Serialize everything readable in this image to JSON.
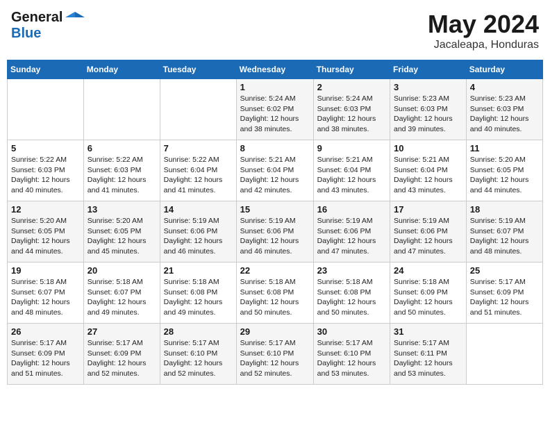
{
  "header": {
    "logo_general": "General",
    "logo_blue": "Blue",
    "title": "May 2024",
    "subtitle": "Jacaleapa, Honduras"
  },
  "weekdays": [
    "Sunday",
    "Monday",
    "Tuesday",
    "Wednesday",
    "Thursday",
    "Friday",
    "Saturday"
  ],
  "weeks": [
    [
      {
        "day": "",
        "info": ""
      },
      {
        "day": "",
        "info": ""
      },
      {
        "day": "",
        "info": ""
      },
      {
        "day": "1",
        "info": "Sunrise: 5:24 AM\nSunset: 6:02 PM\nDaylight: 12 hours\nand 38 minutes."
      },
      {
        "day": "2",
        "info": "Sunrise: 5:24 AM\nSunset: 6:03 PM\nDaylight: 12 hours\nand 38 minutes."
      },
      {
        "day": "3",
        "info": "Sunrise: 5:23 AM\nSunset: 6:03 PM\nDaylight: 12 hours\nand 39 minutes."
      },
      {
        "day": "4",
        "info": "Sunrise: 5:23 AM\nSunset: 6:03 PM\nDaylight: 12 hours\nand 40 minutes."
      }
    ],
    [
      {
        "day": "5",
        "info": "Sunrise: 5:22 AM\nSunset: 6:03 PM\nDaylight: 12 hours\nand 40 minutes."
      },
      {
        "day": "6",
        "info": "Sunrise: 5:22 AM\nSunset: 6:03 PM\nDaylight: 12 hours\nand 41 minutes."
      },
      {
        "day": "7",
        "info": "Sunrise: 5:22 AM\nSunset: 6:04 PM\nDaylight: 12 hours\nand 41 minutes."
      },
      {
        "day": "8",
        "info": "Sunrise: 5:21 AM\nSunset: 6:04 PM\nDaylight: 12 hours\nand 42 minutes."
      },
      {
        "day": "9",
        "info": "Sunrise: 5:21 AM\nSunset: 6:04 PM\nDaylight: 12 hours\nand 43 minutes."
      },
      {
        "day": "10",
        "info": "Sunrise: 5:21 AM\nSunset: 6:04 PM\nDaylight: 12 hours\nand 43 minutes."
      },
      {
        "day": "11",
        "info": "Sunrise: 5:20 AM\nSunset: 6:05 PM\nDaylight: 12 hours\nand 44 minutes."
      }
    ],
    [
      {
        "day": "12",
        "info": "Sunrise: 5:20 AM\nSunset: 6:05 PM\nDaylight: 12 hours\nand 44 minutes."
      },
      {
        "day": "13",
        "info": "Sunrise: 5:20 AM\nSunset: 6:05 PM\nDaylight: 12 hours\nand 45 minutes."
      },
      {
        "day": "14",
        "info": "Sunrise: 5:19 AM\nSunset: 6:06 PM\nDaylight: 12 hours\nand 46 minutes."
      },
      {
        "day": "15",
        "info": "Sunrise: 5:19 AM\nSunset: 6:06 PM\nDaylight: 12 hours\nand 46 minutes."
      },
      {
        "day": "16",
        "info": "Sunrise: 5:19 AM\nSunset: 6:06 PM\nDaylight: 12 hours\nand 47 minutes."
      },
      {
        "day": "17",
        "info": "Sunrise: 5:19 AM\nSunset: 6:06 PM\nDaylight: 12 hours\nand 47 minutes."
      },
      {
        "day": "18",
        "info": "Sunrise: 5:19 AM\nSunset: 6:07 PM\nDaylight: 12 hours\nand 48 minutes."
      }
    ],
    [
      {
        "day": "19",
        "info": "Sunrise: 5:18 AM\nSunset: 6:07 PM\nDaylight: 12 hours\nand 48 minutes."
      },
      {
        "day": "20",
        "info": "Sunrise: 5:18 AM\nSunset: 6:07 PM\nDaylight: 12 hours\nand 49 minutes."
      },
      {
        "day": "21",
        "info": "Sunrise: 5:18 AM\nSunset: 6:08 PM\nDaylight: 12 hours\nand 49 minutes."
      },
      {
        "day": "22",
        "info": "Sunrise: 5:18 AM\nSunset: 6:08 PM\nDaylight: 12 hours\nand 50 minutes."
      },
      {
        "day": "23",
        "info": "Sunrise: 5:18 AM\nSunset: 6:08 PM\nDaylight: 12 hours\nand 50 minutes."
      },
      {
        "day": "24",
        "info": "Sunrise: 5:18 AM\nSunset: 6:09 PM\nDaylight: 12 hours\nand 50 minutes."
      },
      {
        "day": "25",
        "info": "Sunrise: 5:17 AM\nSunset: 6:09 PM\nDaylight: 12 hours\nand 51 minutes."
      }
    ],
    [
      {
        "day": "26",
        "info": "Sunrise: 5:17 AM\nSunset: 6:09 PM\nDaylight: 12 hours\nand 51 minutes."
      },
      {
        "day": "27",
        "info": "Sunrise: 5:17 AM\nSunset: 6:09 PM\nDaylight: 12 hours\nand 52 minutes."
      },
      {
        "day": "28",
        "info": "Sunrise: 5:17 AM\nSunset: 6:10 PM\nDaylight: 12 hours\nand 52 minutes."
      },
      {
        "day": "29",
        "info": "Sunrise: 5:17 AM\nSunset: 6:10 PM\nDaylight: 12 hours\nand 52 minutes."
      },
      {
        "day": "30",
        "info": "Sunrise: 5:17 AM\nSunset: 6:10 PM\nDaylight: 12 hours\nand 53 minutes."
      },
      {
        "day": "31",
        "info": "Sunrise: 5:17 AM\nSunset: 6:11 PM\nDaylight: 12 hours\nand 53 minutes."
      },
      {
        "day": "",
        "info": ""
      }
    ]
  ]
}
